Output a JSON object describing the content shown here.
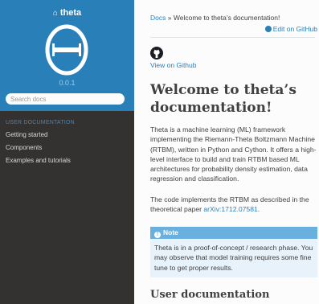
{
  "sidebar": {
    "project_name": "theta",
    "version": "0.0.1",
    "search_placeholder": "Search docs",
    "caption": "USER DOCUMENTATION",
    "items": [
      {
        "label": "Getting started"
      },
      {
        "label": "Components"
      },
      {
        "label": "Examples and tutorials"
      }
    ]
  },
  "breadcrumb": {
    "root": "Docs",
    "separator": "»",
    "current": "Welcome to theta’s documentation!"
  },
  "edit_on_github": "Edit on GitHub",
  "view_on_github": "View on Github",
  "title": "Welcome to theta’s documentation!",
  "intro": "Theta is a machine learning (ML) framework implementing the Riemann-Theta Boltzmann Machine (RTBM), written in Python and Cython. It offers a high-level interface to build and train RTBM based ML architectures for probability density estimation, data regression and classification.",
  "implements_text": "The code implements the RTBM as described in the theoretical paper ",
  "paper_link": "arXiv:1712.07581",
  "implements_end": ".",
  "note": {
    "heading": "Note",
    "body": "Theta is in a proof-of-concept / research phase. You may observe that model training requires some fine tune to get proper results."
  },
  "section_title": "User documentation",
  "colors": {
    "sidebar_bg": "#343131",
    "sidebar_header": "#2980b9",
    "link": "#2980b9",
    "note_header": "#6ab0de",
    "note_bg": "#e7f2fa"
  }
}
